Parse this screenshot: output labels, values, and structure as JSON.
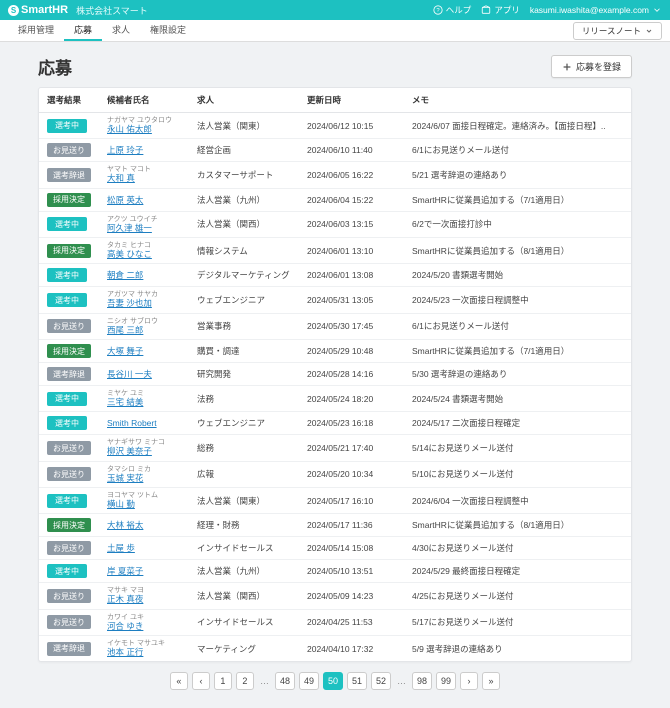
{
  "header": {
    "product": "SmartHR",
    "company": "株式会社スマート",
    "help": "ヘルプ",
    "apps": "アプリ",
    "user_email": "kasumi.iwashita@example.com"
  },
  "tabs": {
    "items": [
      "採用管理",
      "応募",
      "求人",
      "権限設定"
    ],
    "active_index": 1,
    "release_notes": "リリースノート"
  },
  "page": {
    "title": "応募",
    "register_button": "応募を登録"
  },
  "table": {
    "columns": [
      "選考結果",
      "候補者氏名",
      "求人",
      "更新日時",
      "メモ"
    ],
    "rows": [
      {
        "status": "選考中",
        "status_class": "s-senko",
        "kana": "ナガヤマ ユウタロウ",
        "name": "永山 佑太郎",
        "job": "法人営業（関東）",
        "date": "2024/06/12 10:15",
        "memo": "2024/6/07 面接日程確定。連絡済み。【面接日程】.."
      },
      {
        "status": "お見送り",
        "status_class": "s-omiokuri",
        "kana": "",
        "name": "上原 玲子",
        "job": "経営企画",
        "date": "2024/06/10 11:40",
        "memo": "6/1にお見送りメール送付"
      },
      {
        "status": "選考辞退",
        "status_class": "s-jitai",
        "kana": "ヤマト マコト",
        "name": "大和 真",
        "job": "カスタマーサポート",
        "date": "2024/06/05 16:22",
        "memo": "5/21 選考辞退の連絡あり"
      },
      {
        "status": "採用決定",
        "status_class": "s-saiyo",
        "kana": "",
        "name": "松原 英太",
        "job": "法人営業（九州）",
        "date": "2024/06/04 15:22",
        "memo": "SmartHRに従業員追加する（7/1適用日）"
      },
      {
        "status": "選考中",
        "status_class": "s-senko",
        "kana": "アクツ ユウイチ",
        "name": "阿久津 雄一",
        "job": "法人営業（関西）",
        "date": "2024/06/03 13:15",
        "memo": "6/2で一次面接打診中"
      },
      {
        "status": "採用決定",
        "status_class": "s-saiyo",
        "kana": "タカミ ヒナコ",
        "name": "高美 ひなこ",
        "job": "情報システム",
        "date": "2024/06/01 13:10",
        "memo": "SmartHRに従業員追加する（8/1適用日）"
      },
      {
        "status": "選考中",
        "status_class": "s-senko",
        "kana": "",
        "name": "朝倉 二郎",
        "job": "デジタルマーケティング",
        "date": "2024/06/01 13:08",
        "memo": "2024/5/20 書類選考開始"
      },
      {
        "status": "選考中",
        "status_class": "s-senko",
        "kana": "アガツマ サヤカ",
        "name": "吾妻 沙也加",
        "job": "ウェブエンジニア",
        "date": "2024/05/31 13:05",
        "memo": "2024/5/23 一次面接日程調整中"
      },
      {
        "status": "お見送り",
        "status_class": "s-omiokuri",
        "kana": "ニシオ サブロウ",
        "name": "西尾 三郎",
        "job": "営業事務",
        "date": "2024/05/30 17:45",
        "memo": "6/1にお見送りメール送付"
      },
      {
        "status": "採用決定",
        "status_class": "s-saiyo",
        "kana": "",
        "name": "大塚 舞子",
        "job": "購買・調達",
        "date": "2024/05/29 10:48",
        "memo": "SmartHRに従業員追加する（7/1適用日）"
      },
      {
        "status": "選考辞退",
        "status_class": "s-jitai",
        "kana": "",
        "name": "長谷川 一夫",
        "job": "研究開発",
        "date": "2024/05/28 14:16",
        "memo": "5/30 選考辞退の連絡あり"
      },
      {
        "status": "選考中",
        "status_class": "s-senko",
        "kana": "ミヤケ ユミ",
        "name": "三宅 結美",
        "job": "法務",
        "date": "2024/05/24 18:20",
        "memo": "2024/5/24 書類選考開始"
      },
      {
        "status": "選考中",
        "status_class": "s-senko",
        "kana": "",
        "name": "Smith Robert",
        "job": "ウェブエンジニア",
        "date": "2024/05/23 16:18",
        "memo": "2024/5/17 二次面接日程確定"
      },
      {
        "status": "お見送り",
        "status_class": "s-omiokuri",
        "kana": "ヤナギサワ ミナコ",
        "name": "柳沢 美奈子",
        "job": "総務",
        "date": "2024/05/21 17:40",
        "memo": "5/14にお見送りメール送付"
      },
      {
        "status": "お見送り",
        "status_class": "s-omiokuri",
        "kana": "タマシロ ミカ",
        "name": "玉城 実花",
        "job": "広報",
        "date": "2024/05/20 10:34",
        "memo": "5/10にお見送りメール送付"
      },
      {
        "status": "選考中",
        "status_class": "s-senko",
        "kana": "ヨコヤマ ツトム",
        "name": "横山 勤",
        "job": "法人営業（関東）",
        "date": "2024/05/17 16:10",
        "memo": "2024/6/04 一次面接日程調整中"
      },
      {
        "status": "採用決定",
        "status_class": "s-saiyo",
        "kana": "",
        "name": "大林 裕太",
        "job": "経理・財務",
        "date": "2024/05/17 11:36",
        "memo": "SmartHRに従業員追加する（8/1適用日）"
      },
      {
        "status": "お見送り",
        "status_class": "s-omiokuri",
        "kana": "",
        "name": "土屋 歩",
        "job": "インサイドセールス",
        "date": "2024/05/14 15:08",
        "memo": "4/30にお見送りメール送付"
      },
      {
        "status": "選考中",
        "status_class": "s-senko",
        "kana": "",
        "name": "岸 夏菜子",
        "job": "法人営業（九州）",
        "date": "2024/05/10 13:51",
        "memo": "2024/5/29 最終面接日程確定"
      },
      {
        "status": "お見送り",
        "status_class": "s-omiokuri",
        "kana": "マサキ マヨ",
        "name": "正木 真夜",
        "job": "法人営業（関西）",
        "date": "2024/05/09 14:23",
        "memo": "4/25にお見送りメール送付"
      },
      {
        "status": "お見送り",
        "status_class": "s-omiokuri",
        "kana": "カワイ ユキ",
        "name": "河合 ゆき",
        "job": "インサイドセールス",
        "date": "2024/04/25 11:53",
        "memo": "5/17にお見送りメール送付"
      },
      {
        "status": "選考辞退",
        "status_class": "s-jitai",
        "kana": "イケモト マサユキ",
        "name": "池本 正行",
        "job": "マーケティング",
        "date": "2024/04/10 17:32",
        "memo": "5/9 選考辞退の連絡あり"
      }
    ]
  },
  "pagination": {
    "first": "«",
    "prev": "‹",
    "next": "›",
    "last": "»",
    "pages_left": [
      "1",
      "2"
    ],
    "pages_mid": [
      "48",
      "49",
      "50",
      "51",
      "52"
    ],
    "pages_right": [
      "98",
      "99"
    ],
    "current": "50",
    "ellipsis": "…"
  }
}
